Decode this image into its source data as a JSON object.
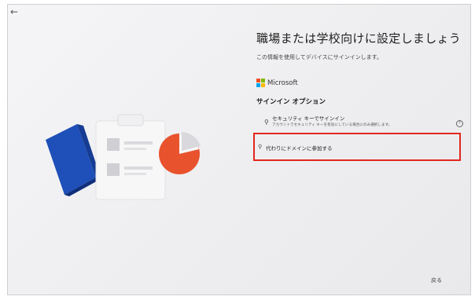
{
  "page": {
    "title": "職場または学校向けに設定しましょう",
    "subtitle": "この情報を使用してデバイスにサインインします。",
    "brand": "Microsoft",
    "section_heading": "サインイン オプション",
    "options": [
      {
        "label": "セキュリティ キーでサインイン",
        "description": "アカウントでセキュリティ キーを有効にしている場合にのみ選択します。",
        "icon": "key-icon"
      },
      {
        "label": "代わりにドメインに参加する",
        "icon": "domain-join-icon"
      }
    ],
    "back_label": "戻る"
  },
  "colors": {
    "highlight": "#e3261e",
    "ms_red": "#f25022",
    "ms_green": "#7fba00",
    "ms_blue": "#00a4ef",
    "ms_yellow": "#ffb900",
    "book_blue": "#1f4fb8",
    "pie_orange": "#e8532e"
  }
}
